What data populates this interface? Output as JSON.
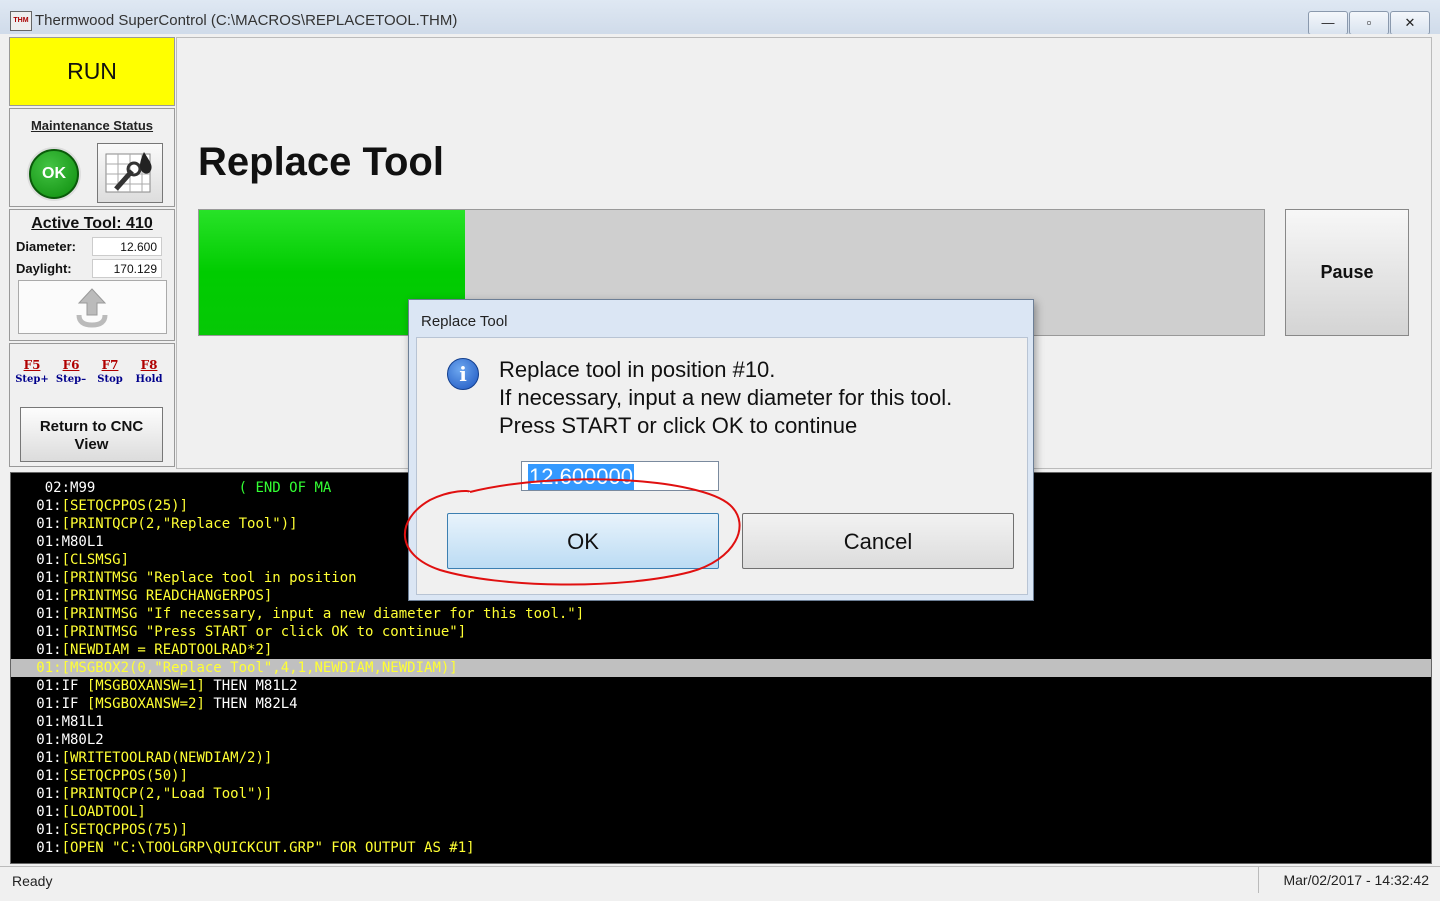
{
  "window": {
    "app_icon": "THM",
    "title": "Thermwood SuperControl (C:\\MACROS\\REPLACETOOL.THM)",
    "controls": {
      "minimize": "—",
      "restore": "▫",
      "close": "✕"
    }
  },
  "sidebar": {
    "run_label": "RUN",
    "maintenance": {
      "title": "Maintenance Status",
      "status_label": "OK",
      "tool_icon": "maintenance-tools-icon"
    },
    "active_tool": {
      "title": "Active Tool: 410",
      "diameter_label": "Diameter:",
      "diameter_value": "12.600",
      "daylight_label": "Daylight:",
      "daylight_value": "170.129",
      "up_icon": "up-arrow-icon"
    },
    "fkeys": [
      {
        "key": "F5",
        "label": "Step+"
      },
      {
        "key": "F6",
        "label": "Step–"
      },
      {
        "key": "F7",
        "label": "Stop"
      },
      {
        "key": "F8",
        "label": "Hold"
      }
    ],
    "return_button": "Return to CNC View"
  },
  "main": {
    "title": "Replace Tool",
    "progress_fraction": 0.25,
    "pause_button": "Pause"
  },
  "code_lines": [
    {
      "pre": "  02:",
      "body": "M99                 ( END OF MA",
      "style": "mixed"
    },
    {
      "pre": " 01:",
      "body": "[SETQCPPOS(25)]"
    },
    {
      "pre": " 01:",
      "body": "[PRINTQCP(2,\"Replace Tool\")]"
    },
    {
      "pre": " 01:",
      "body": "M80L1",
      "white": true
    },
    {
      "pre": " 01:",
      "body": "[CLSMSG]"
    },
    {
      "pre": " 01:",
      "body": "[PRINTMSG \"Replace tool in position"
    },
    {
      "pre": " 01:",
      "body": "[PRINTMSG READCHANGERPOS]"
    },
    {
      "pre": " 01:",
      "body": "[PRINTMSG \"If necessary, input a new diameter for this tool.\"]"
    },
    {
      "pre": " 01:",
      "body": "[PRINTMSG \"Press START or click OK to continue\"]"
    },
    {
      "pre": " 01:",
      "body": "[NEWDIAM = READTOOLRAD*2]"
    },
    {
      "pre": " 01:",
      "body": "[MSGBOX2(0,\"Replace Tool\",4,1,NEWDIAM,NEWDIAM)]",
      "selected": true
    },
    {
      "pre": " 01:",
      "body": "IF [MSGBOXANSW=1] THEN M81L2",
      "mixed_if": true
    },
    {
      "pre": " 01:",
      "body": "IF [MSGBOXANSW=2] THEN M82L4",
      "mixed_if": true
    },
    {
      "pre": " 01:",
      "body": "M81L1",
      "white": true
    },
    {
      "pre": " 01:",
      "body": "M80L2",
      "white": true
    },
    {
      "pre": " 01:",
      "body": "[WRITETOOLRAD(NEWDIAM/2)]"
    },
    {
      "pre": " 01:",
      "body": "[SETQCPPOS(50)]"
    },
    {
      "pre": " 01:",
      "body": "[PRINTQCP(2,\"Load Tool\")]"
    },
    {
      "pre": " 01:",
      "body": "[LOADTOOL]"
    },
    {
      "pre": " 01:",
      "body": "[SETQCPPOS(75)]"
    },
    {
      "pre": " 01:",
      "body": "[OPEN \"C:\\TOOLGRP\\QUICKCUT.GRP\" FOR OUTPUT AS #1]"
    }
  ],
  "dialog": {
    "title": "Replace Tool",
    "info_icon": "info-icon",
    "message_lines": [
      "Replace tool in position #10.",
      "If necessary, input a new diameter for this tool.",
      "Press START or click OK to continue"
    ],
    "input_value": "12.600000",
    "ok_button": "OK",
    "cancel_button": "Cancel"
  },
  "statusbar": {
    "left": "Ready",
    "right": "Mar/02/2017 - 14:32:42"
  },
  "colors": {
    "run_bg": "#ffff00",
    "progress_fill": "#00cc00",
    "code_text": "#ffff33",
    "annotation_red": "#e01010"
  }
}
